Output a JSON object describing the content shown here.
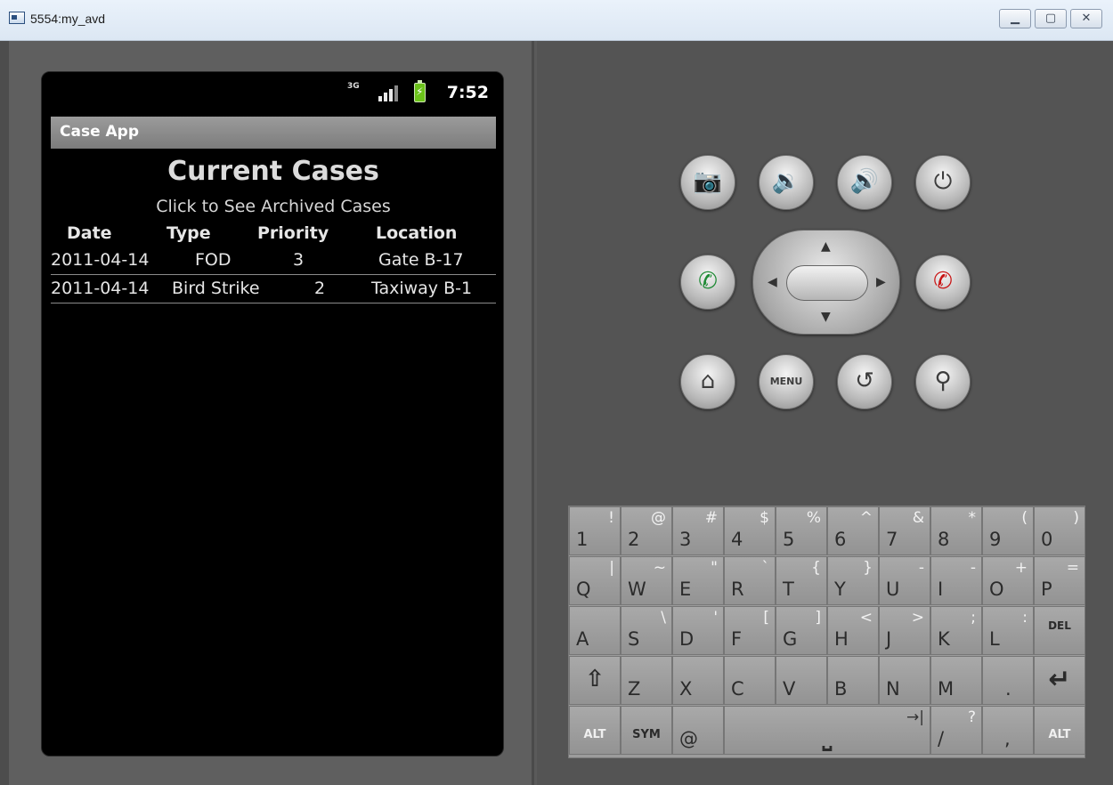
{
  "window": {
    "title": "5554:my_avd"
  },
  "statusbar": {
    "network": "3G",
    "time": "7:52",
    "battery_bolt": "⚡"
  },
  "app": {
    "title": "Case App",
    "heading": "Current Cases",
    "archive_link": "Click to See Archived Cases",
    "columns": [
      "Date",
      "Type",
      "Priority",
      "Location"
    ],
    "rows": [
      {
        "date": "2011-04-14",
        "type": "FOD",
        "priority": "3",
        "location": "Gate B-17"
      },
      {
        "date": "2011-04-14",
        "type": "Bird Strike",
        "priority": "2",
        "location": "Taxiway B-1"
      }
    ]
  },
  "controls": {
    "camera": "📷",
    "vol_down": "🔉",
    "vol_up": "🔊",
    "power": "⏻",
    "call": "✆",
    "end_call": "✆",
    "home": "⌂",
    "menu": "MENU",
    "back": "↺",
    "search": "⚲"
  },
  "keyboard": {
    "row1": [
      [
        "1",
        "!"
      ],
      [
        "2",
        "@"
      ],
      [
        "3",
        "#"
      ],
      [
        "4",
        "$"
      ],
      [
        "5",
        "%"
      ],
      [
        "6",
        "^"
      ],
      [
        "7",
        "&"
      ],
      [
        "8",
        "*"
      ],
      [
        "9",
        "("
      ],
      [
        "0",
        ")"
      ]
    ],
    "row2": [
      [
        "Q",
        "|"
      ],
      [
        "W",
        "~"
      ],
      [
        "E",
        "\""
      ],
      [
        "R",
        "`"
      ],
      [
        "T",
        "{"
      ],
      [
        "Y",
        "}"
      ],
      [
        "U",
        "-"
      ],
      [
        "I",
        "-"
      ],
      [
        "O",
        "+"
      ],
      [
        "P",
        "="
      ]
    ],
    "row3": [
      [
        "A",
        ""
      ],
      [
        "S",
        "\\"
      ],
      [
        "D",
        "'"
      ],
      [
        "F",
        "["
      ],
      [
        "G",
        "]"
      ],
      [
        "H",
        "<"
      ],
      [
        "J",
        ">"
      ],
      [
        "K",
        ";"
      ],
      [
        "L",
        ":"
      ],
      [
        "DEL",
        ""
      ]
    ],
    "row4": [
      [
        "⇧",
        ""
      ],
      [
        "Z",
        ""
      ],
      [
        "X",
        ""
      ],
      [
        "C",
        ""
      ],
      [
        "V",
        ""
      ],
      [
        "B",
        ""
      ],
      [
        "N",
        ""
      ],
      [
        "M",
        ""
      ],
      [
        ".",
        ""
      ],
      [
        "↵",
        ""
      ]
    ],
    "row5_alt": "ALT",
    "row5_sym": "SYM",
    "row5_at": "@",
    "row5_space": "⎵",
    "row5_tab": "→|",
    "row5_slash": "/",
    "row5_question": "?",
    "row5_comma": ",",
    "row5_alt2": "ALT"
  }
}
